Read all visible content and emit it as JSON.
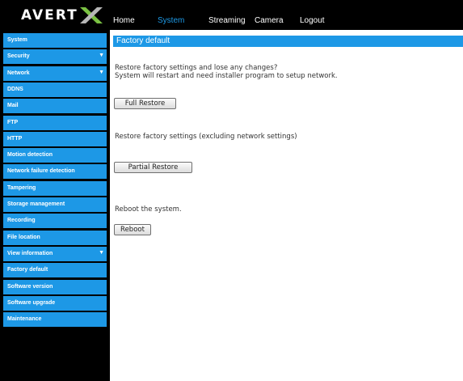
{
  "logo": {
    "text": "AVERT",
    "icon": "avertx-x-logo"
  },
  "nav": {
    "items": [
      "Home",
      "System",
      "Streaming",
      "Camera",
      "Logout"
    ],
    "active": "System"
  },
  "sidebar": {
    "items": [
      {
        "label": "System",
        "expandable": false
      },
      {
        "label": "Security",
        "expandable": true
      },
      {
        "label": "Network",
        "expandable": true
      },
      {
        "label": "DDNS",
        "expandable": false
      },
      {
        "label": "Mail",
        "expandable": false
      },
      {
        "label": "FTP",
        "expandable": false
      },
      {
        "label": "HTTP",
        "expandable": false
      },
      {
        "label": "Motion detection",
        "expandable": false
      },
      {
        "label": "Network failure detection",
        "expandable": false
      },
      {
        "label": "Tampering",
        "expandable": false
      },
      {
        "label": "Storage management",
        "expandable": false
      },
      {
        "label": "Recording",
        "expandable": false
      },
      {
        "label": "File location",
        "expandable": false
      },
      {
        "label": "View information",
        "expandable": true
      },
      {
        "label": "Factory default",
        "expandable": false
      },
      {
        "label": "Software version",
        "expandable": false
      },
      {
        "label": "Software upgrade",
        "expandable": false
      },
      {
        "label": "Maintenance",
        "expandable": false
      }
    ],
    "arrow_glyph": "▼"
  },
  "content": {
    "header": "Factory default",
    "full_restore_text_1": "Restore factory settings and lose any changes?",
    "full_restore_text_2": "System will restart and need installer program to setup network.",
    "full_restore_button": "Full Restore",
    "partial_restore_text": "Restore factory settings (excluding network settings)",
    "partial_restore_button": "Partial Restore",
    "reboot_text": "Reboot the system.",
    "reboot_button": "Reboot"
  },
  "colors": {
    "accent": "#1d98e6",
    "nav_active": "#1e9be8",
    "background_dark": "#000000",
    "logo_x_green": "#7ac143"
  }
}
